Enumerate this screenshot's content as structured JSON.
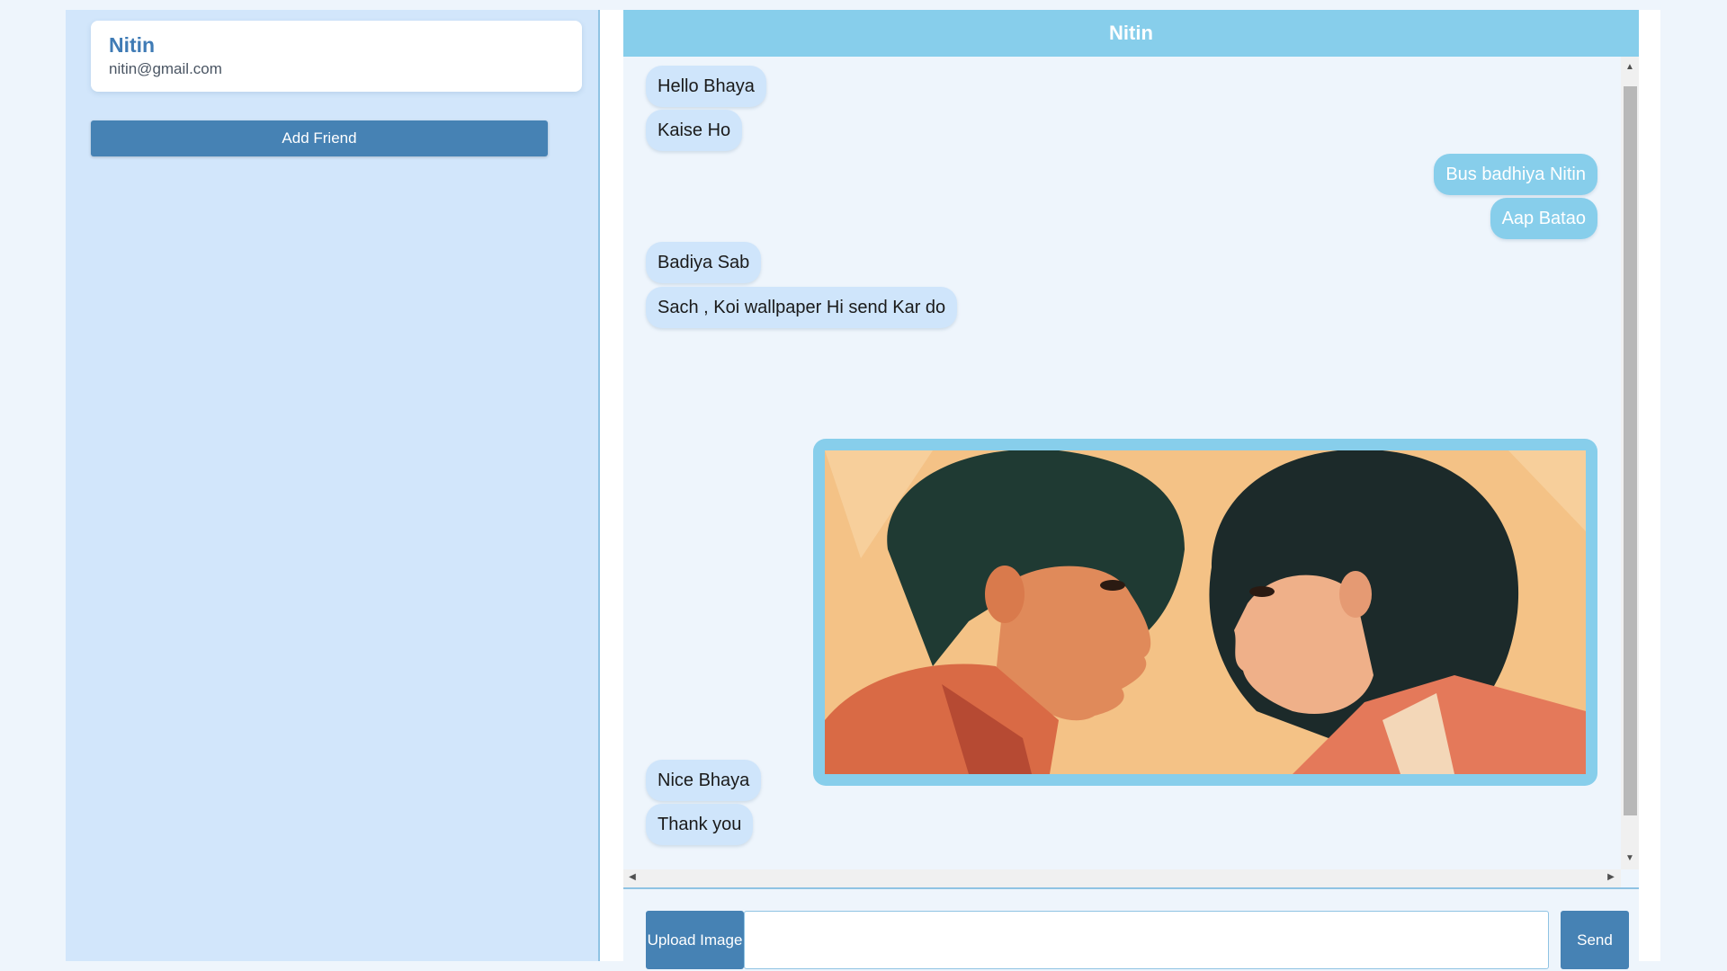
{
  "sidebar": {
    "user": {
      "name": "Nitin",
      "email": "nitin@gmail.com"
    },
    "add_friend_label": "Add Friend"
  },
  "chat": {
    "header_title": "Nitin",
    "messages": [
      {
        "direction": "in",
        "text": "Hello Bhaya"
      },
      {
        "direction": "in",
        "text": "Kaise Ho"
      },
      {
        "direction": "out",
        "text": "Bus badhiya Nitin"
      },
      {
        "direction": "out",
        "text": "Aap Batao"
      },
      {
        "direction": "in",
        "text": "Badiya Sab"
      },
      {
        "direction": "in",
        "text": "Sach , Koi wallpaper Hi send Kar do"
      },
      {
        "direction": "out",
        "type": "image",
        "description": "anime-wallpaper-two-faces"
      },
      {
        "direction": "in",
        "text": "Nice Bhaya"
      },
      {
        "direction": "in",
        "text": "Thank you"
      }
    ],
    "composer": {
      "upload_label": "Upload Image",
      "input_value": "",
      "input_placeholder": "",
      "send_label": "Send"
    }
  },
  "colors": {
    "accent": "#4682b4",
    "header": "#87ceeb",
    "sidebar_bg": "#d2e6fb",
    "incoming_bubble": "#cfe5fb",
    "outgoing_bubble": "#87ceeb"
  }
}
